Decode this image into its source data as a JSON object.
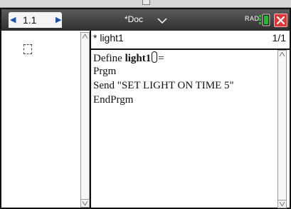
{
  "app": {
    "tab_label": "1.1",
    "document_name": "*Doc",
    "angle_mode": "RAD"
  },
  "icons": {
    "tab_prev": "chevron-left-icon",
    "tab_next": "chevron-right-icon",
    "doc_menu": "chevron-down-icon",
    "battery": "battery-icon",
    "close": "close-icon",
    "empty_math_box": "placeholder-box-icon"
  },
  "colors": {
    "title_bar": "#3c3c3c",
    "tab_arrows": "#1a52a8",
    "battery": "#2fb52f",
    "close": "#d83a3a"
  },
  "editor": {
    "program_name": "* light1",
    "page_indicator": "1/1",
    "code": {
      "line1_keyword": "Define ",
      "line1_name": "light1",
      "line1_suffix": "=",
      "line2": "Prgm",
      "line3": "Send \"SET LIGHT ON TIME 5\"",
      "line4": "EndPrgm"
    }
  }
}
